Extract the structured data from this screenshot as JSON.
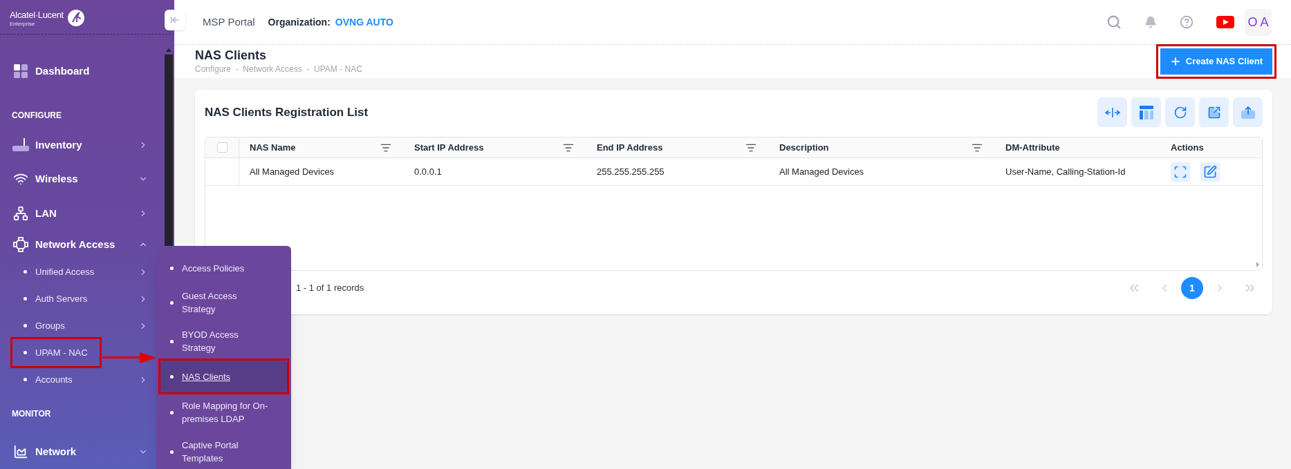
{
  "sidebar": {
    "brand": "Alcatel·Lucent",
    "brand_sub": "Enterprise",
    "items": [
      {
        "kind": "nav",
        "label": "Dashboard",
        "annotated": false
      },
      {
        "kind": "heading",
        "label": "CONFIGURE"
      },
      {
        "kind": "nav",
        "label": "Inventory",
        "has_submenu": true,
        "annotated": false
      },
      {
        "kind": "nav",
        "label": "Wireless",
        "expanded": false,
        "annotated": false
      },
      {
        "kind": "nav",
        "label": "LAN",
        "has_submenu": true,
        "annotated": false
      },
      {
        "kind": "nav",
        "label": "Network Access",
        "expanded": true,
        "annotated": false
      },
      {
        "kind": "sub",
        "label": "Unified Access",
        "has_submenu": true,
        "annotated": false
      },
      {
        "kind": "sub",
        "label": "Auth Servers",
        "has_submenu": true,
        "annotated": false
      },
      {
        "kind": "sub",
        "label": "Groups",
        "has_submenu": true,
        "annotated": false
      },
      {
        "kind": "sub",
        "label": "UPAM - NAC",
        "has_submenu": false,
        "annotated": true
      },
      {
        "kind": "sub",
        "label": "Accounts",
        "has_submenu": true,
        "annotated": false
      },
      {
        "kind": "heading",
        "label": "MONITOR"
      },
      {
        "kind": "nav",
        "label": "Network",
        "expanded": false,
        "annotated": false
      }
    ]
  },
  "flyout": {
    "items": [
      {
        "label": "Access Policies",
        "selected": false,
        "annotated": false
      },
      {
        "label": "Guest Access Strategy",
        "selected": false,
        "annotated": false
      },
      {
        "label": "BYOD Access Strategy",
        "selected": false,
        "annotated": false
      },
      {
        "label": "NAS Clients",
        "selected": true,
        "annotated": true
      },
      {
        "label": "Role Mapping for On-premises LDAP",
        "selected": false,
        "annotated": false
      },
      {
        "label": "Captive Portal Templates",
        "selected": false,
        "annotated": false
      }
    ]
  },
  "annotation_arrow": true,
  "header": {
    "portal": "MSP Portal",
    "org_label": "Organization:",
    "org_name": "OVNG AUTO",
    "avatar": "O A"
  },
  "page": {
    "title": "NAS Clients",
    "breadcrumb": "Configure  -  Network Access  -  UPAM - NAC",
    "create_button": {
      "label": "Create NAS Client",
      "annotated": true
    }
  },
  "card": {
    "title": "NAS Clients Registration List",
    "table": {
      "select_all_checked": false,
      "columns": [
        {
          "label": "NAS Name",
          "filter": true
        },
        {
          "label": "Start IP Address",
          "filter": true
        },
        {
          "label": "End IP Address",
          "filter": true
        },
        {
          "label": "Description",
          "filter": true
        },
        {
          "label": "DM-Attribute",
          "filter": false
        },
        {
          "label": "Actions",
          "filter": false
        }
      ],
      "rows": [
        {
          "cells": [
            "All Managed Devices",
            "0.0.0.1",
            "255.255.255.255",
            "All Managed Devices",
            "User-Name, Calling-Station-Id"
          ]
        }
      ]
    },
    "pagination": {
      "summary": "1 - 1 of 1 records",
      "pages": [
        {
          "label": "1",
          "selected": true
        }
      ]
    }
  }
}
